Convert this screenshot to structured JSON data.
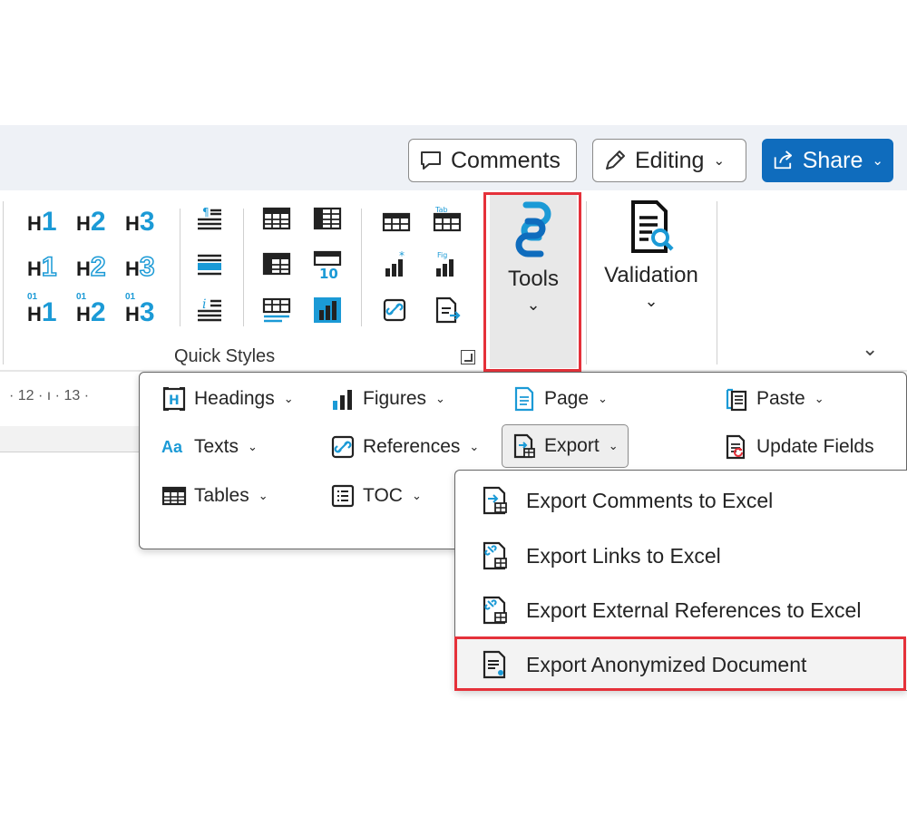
{
  "titlebar": {
    "comments_label": "Comments",
    "editing_label": "Editing",
    "share_label": "Share"
  },
  "ribbon": {
    "quick_styles_label": "Quick Styles",
    "headings": [
      {
        "prefix": "",
        "letter": "H",
        "num": "1"
      },
      {
        "prefix": "",
        "letter": "H",
        "num": "2"
      },
      {
        "prefix": "",
        "letter": "H",
        "num": "3"
      }
    ],
    "tools_label": "Tools",
    "validation_label": "Validation"
  },
  "ruler": {
    "text": "· 12 · ı · 13 ·"
  },
  "tools_menu": {
    "items": [
      {
        "label": "Headings",
        "icon": "heading-icon"
      },
      {
        "label": "Figures",
        "icon": "figures-icon"
      },
      {
        "label": "Page",
        "icon": "page-icon"
      },
      {
        "label": "Paste",
        "icon": "paste-icon"
      },
      {
        "label": "Texts",
        "icon": "texts-icon"
      },
      {
        "label": "References",
        "icon": "references-icon"
      },
      {
        "label": "Export",
        "icon": "export-icon"
      },
      {
        "label": "Update Fields",
        "icon": "update-fields-icon"
      },
      {
        "label": "Tables",
        "icon": "tables-icon"
      },
      {
        "label": "TOC",
        "icon": "toc-icon"
      }
    ],
    "texts_glyph": "Aa"
  },
  "export_menu": {
    "items": [
      {
        "label": "Export Comments to Excel"
      },
      {
        "label": "Export Links to Excel"
      },
      {
        "label": "Export External References to Excel"
      },
      {
        "label": "Export Anonymized Document"
      }
    ]
  },
  "colors": {
    "accent_blue": "#1b9ad6",
    "share_blue": "#0f6cbd",
    "highlight_red": "#e5313a"
  }
}
